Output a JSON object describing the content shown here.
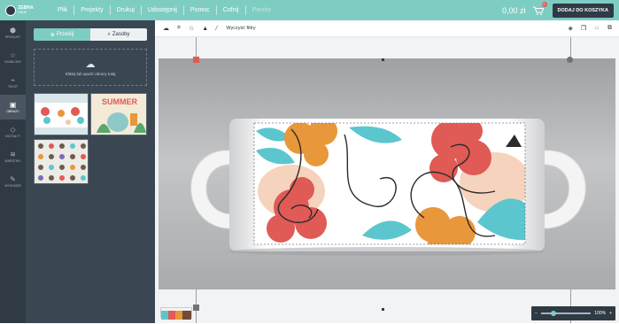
{
  "brand": {
    "name": "ZEBRA",
    "sub": "DRUK"
  },
  "menu": [
    "Plik",
    "Projekty",
    "Drukuj",
    "Udostępnij",
    "Pomoc"
  ],
  "history": {
    "undo": "Cofnij",
    "redo": "Ponów"
  },
  "cart": {
    "price": "0,00 zł",
    "count": "0",
    "add_label": "DODAJ DO KOSZYKA"
  },
  "rail": [
    "PRODUKT",
    "SZABLONY",
    "TEKST",
    "OBRAZY",
    "KSZTAŁTY",
    "WARSTWY",
    "WYSONÓR"
  ],
  "panel": {
    "tabs": [
      "Prześlij",
      "Zasoby"
    ],
    "dropzone": "Kliknij lub upuść obrazy tutaj"
  },
  "toolbar": {
    "clear_filters": "Wyczyść filtry"
  },
  "zoom": {
    "minus": "−",
    "value": "100%",
    "plus": "+"
  },
  "colors": {
    "teal": "#7ecdc2",
    "dark": "#2f3a44",
    "coral": "#e05a56",
    "orange": "#e8973a",
    "cyan": "#5cc6cf",
    "peach": "#f5c9a8"
  }
}
